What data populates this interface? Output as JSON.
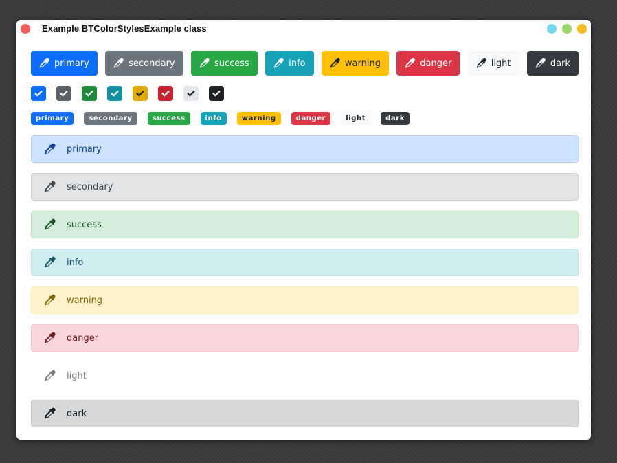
{
  "window": {
    "title": "Example BTColorStylesExample class"
  },
  "colors": {
    "primary": "#0d6efd",
    "secondary": "#6c757d",
    "success": "#28a745",
    "info": "#17a2b8",
    "warning": "#ffc107",
    "danger": "#dc3545",
    "light": "#f8f9fa",
    "dark": "#343a40"
  },
  "icons": {
    "button": "eyedropper-icon",
    "checkbox": "check-icon",
    "alert": "eyedropper-icon"
  },
  "buttons": [
    {
      "key": "primary",
      "label": "primary",
      "bg": "#0d6efd",
      "fg": "#ffffff"
    },
    {
      "key": "secondary",
      "label": "secondary",
      "bg": "#6c757d",
      "fg": "#ffffff"
    },
    {
      "key": "success",
      "label": "success",
      "bg": "#28a745",
      "fg": "#ffffff"
    },
    {
      "key": "info",
      "label": "info",
      "bg": "#17a2b8",
      "fg": "#ffffff"
    },
    {
      "key": "warning",
      "label": "warning",
      "bg": "#ffc107",
      "fg": "#1f2429"
    },
    {
      "key": "danger",
      "label": "danger",
      "bg": "#dc3545",
      "fg": "#ffffff"
    },
    {
      "key": "light",
      "label": "light",
      "bg": "#f8f9fa",
      "fg": "#1f2429"
    },
    {
      "key": "dark",
      "label": "dark",
      "bg": "#343a40",
      "fg": "#ffffff"
    }
  ],
  "checkboxes": [
    {
      "key": "primary",
      "bg": "#0d6efd",
      "fg": "#ffffff",
      "checked": true
    },
    {
      "key": "secondary",
      "bg": "#5a6268",
      "fg": "#ffffff",
      "checked": true
    },
    {
      "key": "success",
      "bg": "#1e8a3a",
      "fg": "#ffffff",
      "checked": true
    },
    {
      "key": "info",
      "bg": "#138ea2",
      "fg": "#ffffff",
      "checked": true
    },
    {
      "key": "warning",
      "bg": "#e0a800",
      "fg": "#1f2429",
      "checked": true
    },
    {
      "key": "danger",
      "bg": "#c82333",
      "fg": "#ffffff",
      "checked": true
    },
    {
      "key": "light",
      "bg": "#e2e6ea",
      "fg": "#1f2429",
      "checked": true
    },
    {
      "key": "dark",
      "bg": "#1d2124",
      "fg": "#ffffff",
      "checked": true
    }
  ],
  "badges": [
    {
      "key": "primary",
      "label": "primary",
      "bg": "#0d6efd",
      "fg": "#ffffff"
    },
    {
      "key": "secondary",
      "label": "secondary",
      "bg": "#6c757d",
      "fg": "#ffffff"
    },
    {
      "key": "success",
      "label": "success",
      "bg": "#28a745",
      "fg": "#ffffff"
    },
    {
      "key": "info",
      "label": "info",
      "bg": "#17a2b8",
      "fg": "#ffffff"
    },
    {
      "key": "warning",
      "label": "warning",
      "bg": "#ffc107",
      "fg": "#1f2429"
    },
    {
      "key": "danger",
      "label": "danger",
      "bg": "#dc3545",
      "fg": "#ffffff"
    },
    {
      "key": "light",
      "label": "light",
      "bg": "#f8f9fa",
      "fg": "#1f2429"
    },
    {
      "key": "dark",
      "label": "dark",
      "bg": "#343a40",
      "fg": "#ffffff"
    }
  ],
  "alerts": [
    {
      "key": "primary",
      "label": "primary",
      "bg": "#cfe2ff",
      "border": "#b6d4fe",
      "fg": "#084298"
    },
    {
      "key": "secondary",
      "label": "secondary",
      "bg": "#e2e3e5",
      "border": "#d3d6d8",
      "fg": "#41464b"
    },
    {
      "key": "success",
      "label": "success",
      "bg": "#d4edda",
      "border": "#c3e6cb",
      "fg": "#155724"
    },
    {
      "key": "info",
      "label": "info",
      "bg": "#d1ecf1",
      "border": "#bee5eb",
      "fg": "#0c5460"
    },
    {
      "key": "warning",
      "label": "warning",
      "bg": "#fff3cd",
      "border": "#ffeeba",
      "fg": "#856404"
    },
    {
      "key": "danger",
      "label": "danger",
      "bg": "#f8d7da",
      "border": "#f5c6cb",
      "fg": "#721c24"
    },
    {
      "key": "light",
      "label": "light",
      "bg": "#fefefe",
      "border": "#fdfdfe",
      "fg": "#818182"
    },
    {
      "key": "dark",
      "label": "dark",
      "bg": "#d6d8d9",
      "border": "#c6c8ca",
      "fg": "#1b1e21"
    }
  ]
}
